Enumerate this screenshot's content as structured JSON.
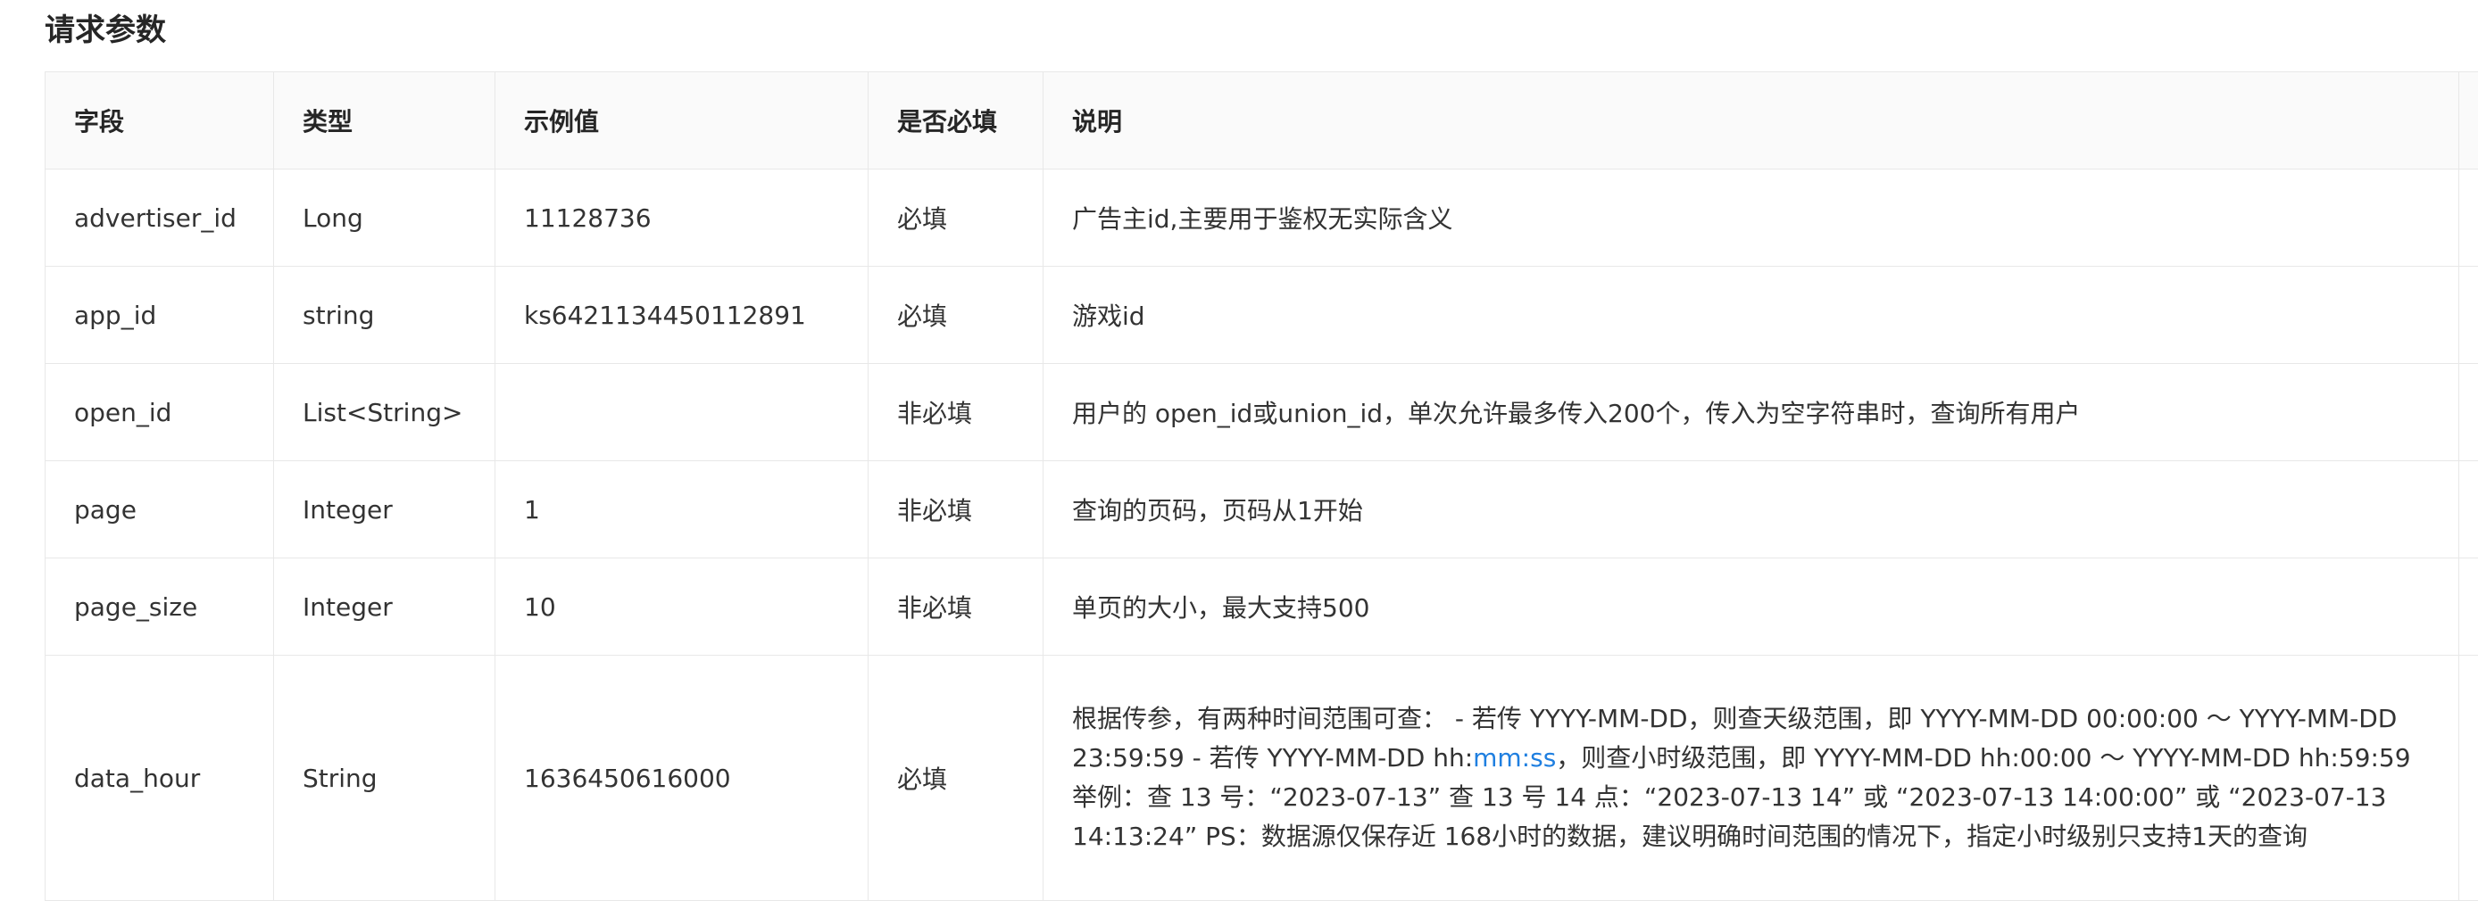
{
  "section_title": "请求参数",
  "table": {
    "headers": [
      "字段",
      "类型",
      "示例值",
      "是否必填",
      "说明"
    ],
    "rows": [
      {
        "field": "advertiser_id",
        "type": "Long",
        "example": "11128736",
        "required": "必填",
        "desc": "广告主id,主要用于鉴权无实际含义"
      },
      {
        "field": "app_id",
        "type": "string",
        "example": "ks642113445011289​1",
        "required": "必填",
        "desc": "游戏id"
      },
      {
        "field": "open_id",
        "type": "List<String>",
        "example": "",
        "required": "非必填",
        "desc": "用户的 open_id或union_id，单次允许最多传入200个，传入为空字符串时，查询所有用户"
      },
      {
        "field": "page",
        "type": "Integer",
        "example": "1",
        "required": "非必填",
        "desc": "查询的页码，页码从1开始"
      },
      {
        "field": "page_size",
        "type": "Integer",
        "example": "10",
        "required": "非必填",
        "desc": "单页的大小，最大支持500"
      },
      {
        "field": "data_hour",
        "type": "String",
        "example": "1636450616000",
        "required": "必填",
        "desc_before": "根据传参，有两种时间范围可查： - 若传 YYYY-MM-DD，则查天级范围，即 YYYY-MM-DD 00:00:00 ～ YYYY-MM-DD 23:59:59 - 若传 YYYY-MM-DD hh:",
        "desc_link": "mm:ss",
        "desc_after": "，则查小时级范围，即 YYYY-MM-DD hh:00:00 ～ YYYY-MM-DD hh:59:59 举例：查 13 号：“2023-07-13” 查 13 号 14 点：“2023-07-13 14” 或 “2023-07-13 14:00:00” 或 “2023-07-13 14:13:24” PS：数据源仅保存近 168小时的数据，建议明确时间范围的情况下，指定小时级别只支持1天的查询"
      }
    ]
  }
}
